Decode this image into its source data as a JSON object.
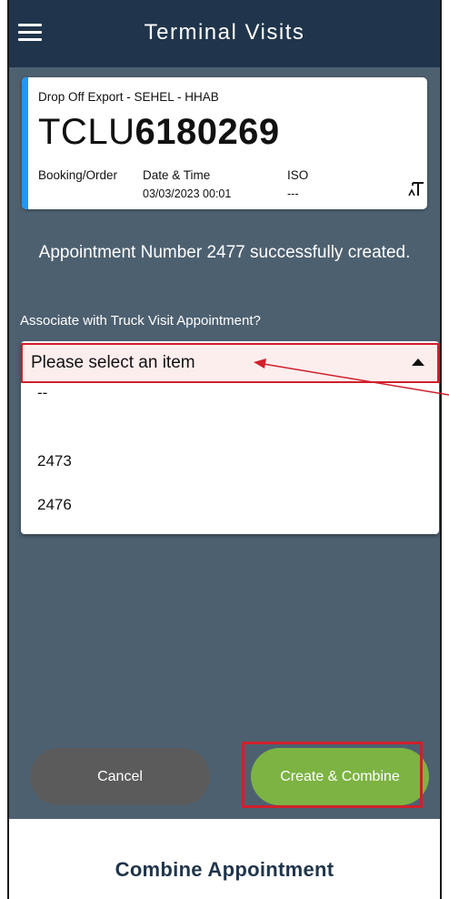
{
  "header": {
    "title": "Terminal Visits"
  },
  "card": {
    "type": "Drop Off Export - SEHEL - HHAB",
    "container_prefix": "TCLU",
    "container_number": "6180269",
    "booking_label": "Booking/Order",
    "datetime_label": "Date & Time",
    "datetime_value": "03/03/2023 00:01",
    "iso_label": "ISO",
    "iso_value": "---"
  },
  "message": "Appointment Number 2477 successfully created.",
  "associate_label": "Associate with Truck Visit Appointment?",
  "select": {
    "placeholder": "Please select an item",
    "options": [
      "--",
      "2473",
      "2476"
    ]
  },
  "buttons": {
    "cancel": "Cancel",
    "create_combine": "Create & Combine"
  },
  "sheet": {
    "title": "Combine Appointment"
  },
  "colors": {
    "header": "#20354b",
    "background": "#4d6070",
    "accent": "#2196f3",
    "primary_button": "#7cb342",
    "annotation": "#d0202c"
  }
}
